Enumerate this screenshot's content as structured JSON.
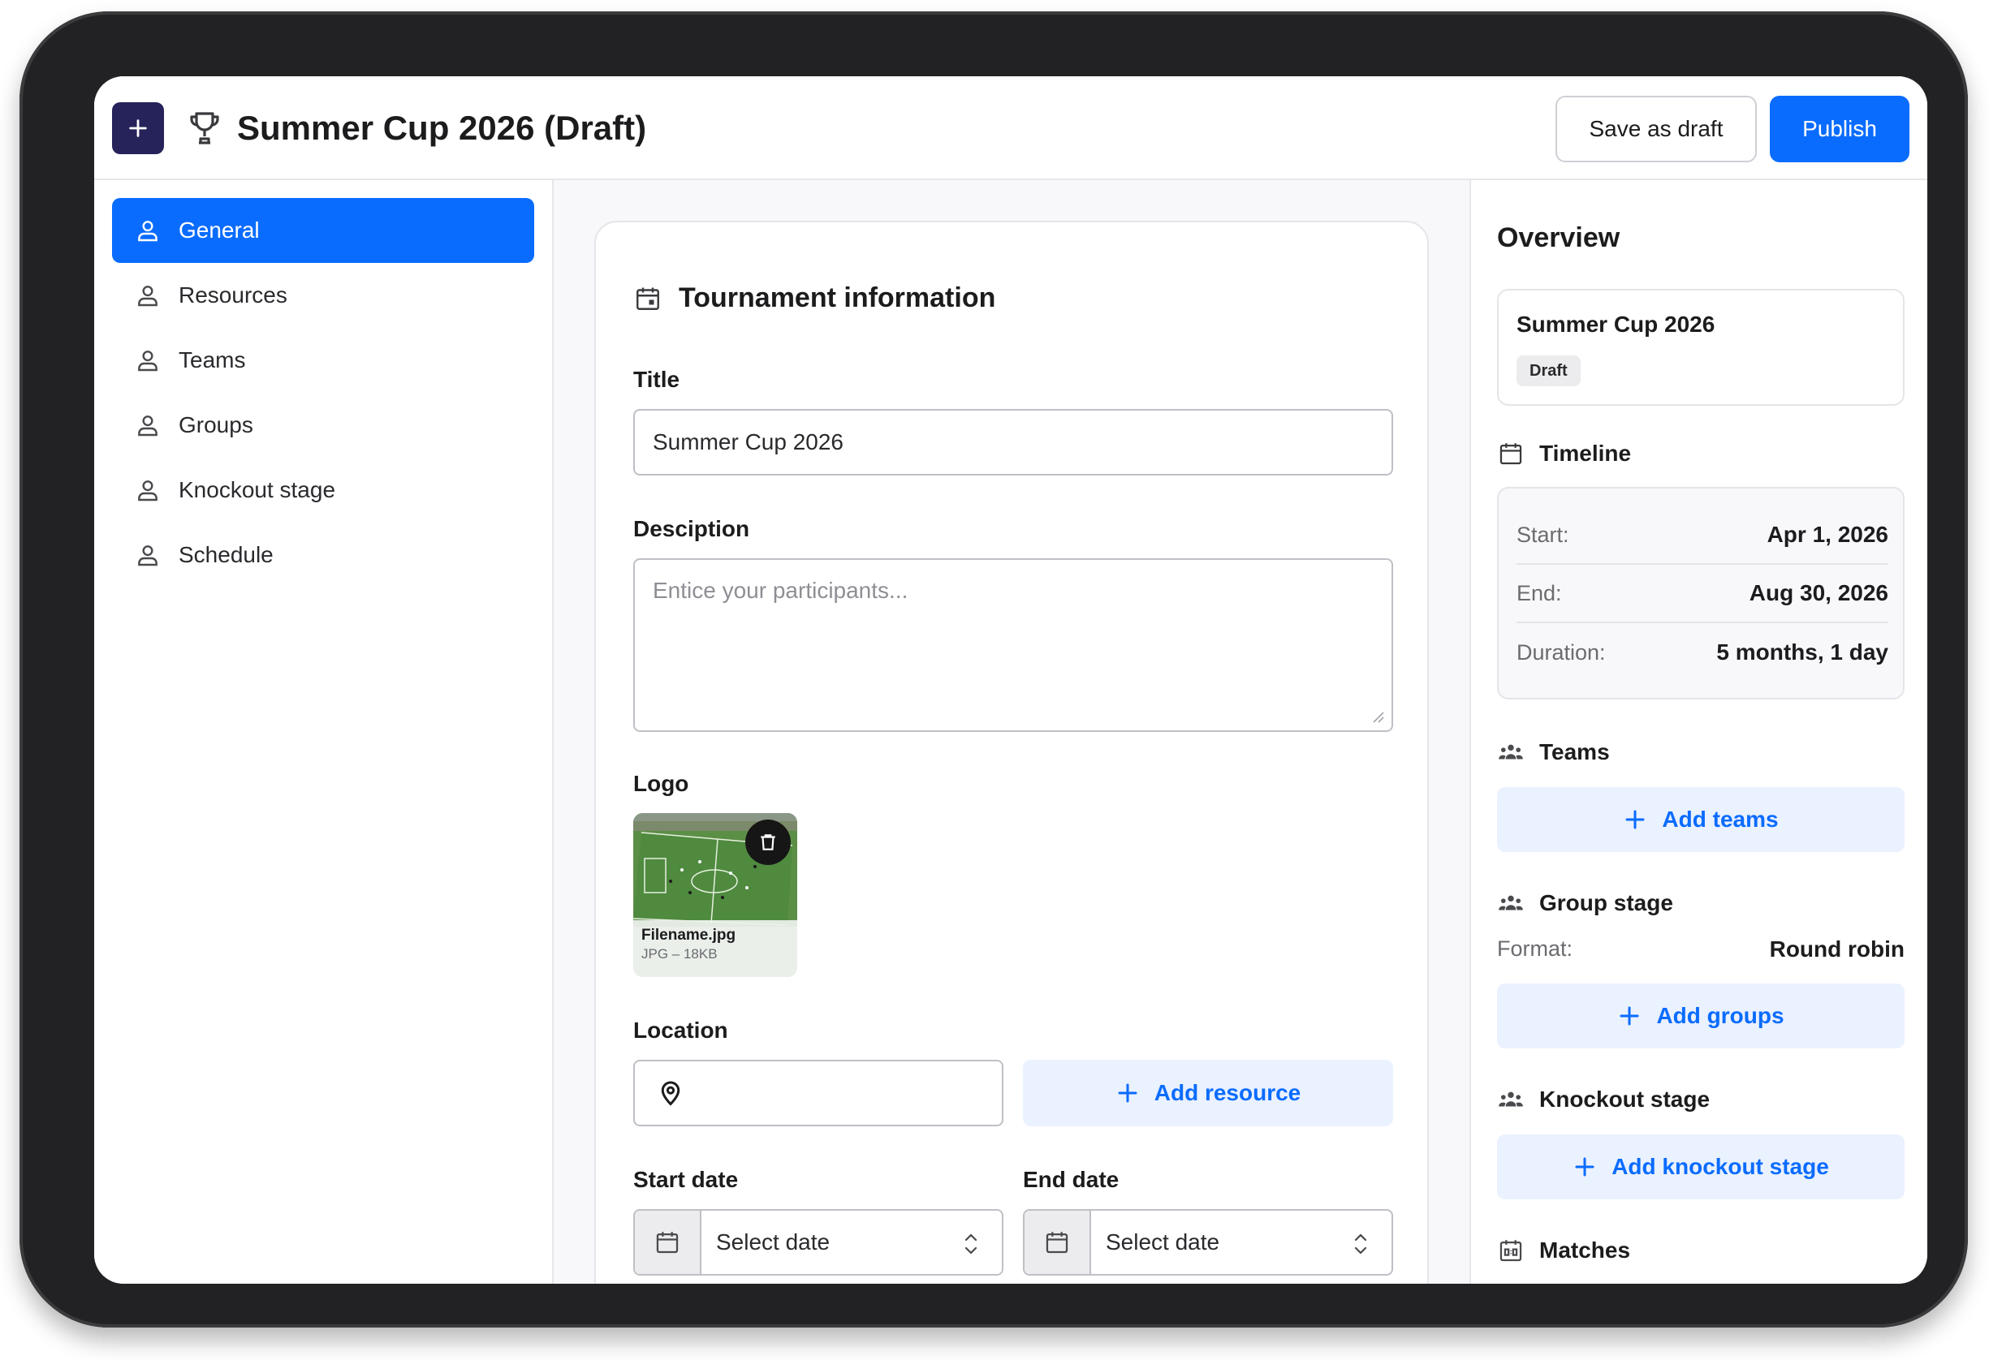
{
  "header": {
    "title": "Summer Cup 2026 (Draft)",
    "save_draft_label": "Save as draft",
    "publish_label": "Publish"
  },
  "sidebar": {
    "items": [
      {
        "label": "General",
        "active": true
      },
      {
        "label": "Resources",
        "active": false
      },
      {
        "label": "Teams",
        "active": false
      },
      {
        "label": "Groups",
        "active": false
      },
      {
        "label": "Knockout stage",
        "active": false
      },
      {
        "label": "Schedule",
        "active": false
      }
    ]
  },
  "form": {
    "section_title": "Tournament information",
    "title_label": "Title",
    "title_value": "Summer Cup 2026",
    "description_label": "Desciption",
    "description_placeholder": "Entice your participants...",
    "logo_label": "Logo",
    "logo_filename": "Filename.jpg",
    "logo_meta": "JPG – 18KB",
    "location_label": "Location",
    "location_value": "",
    "add_resource_label": "Add resource",
    "start_date_label": "Start date",
    "start_date_placeholder": "Select date",
    "end_date_label": "End date",
    "end_date_placeholder": "Select date"
  },
  "overview": {
    "title": "Overview",
    "summary_name": "Summer Cup 2026",
    "status_badge": "Draft",
    "timeline": {
      "heading": "Timeline",
      "start_label": "Start:",
      "start_value": "Apr 1, 2026",
      "end_label": "End:",
      "end_value": "Aug 30, 2026",
      "duration_label": "Duration:",
      "duration_value": "5 months, 1 day"
    },
    "teams": {
      "heading": "Teams",
      "button": "Add teams"
    },
    "group_stage": {
      "heading": "Group stage",
      "format_label": "Format:",
      "format_value": "Round robin",
      "button": "Add groups"
    },
    "knockout": {
      "heading": "Knockout stage",
      "button": "Add knockout stage"
    },
    "matches": {
      "heading": "Matches"
    }
  },
  "colors": {
    "primary": "#0a6cff",
    "brand_dark": "#26235a",
    "ghost_bg": "#eaf1ff",
    "device_bezel": "#222224"
  },
  "icons": {
    "nav_item": "user-icon",
    "header_add": "plus-icon",
    "header_title": "trophy-icon",
    "section": "calendar-icon",
    "location": "map-pin-icon",
    "logo_remove": "trash-icon",
    "overview_sections": "users-icon"
  }
}
